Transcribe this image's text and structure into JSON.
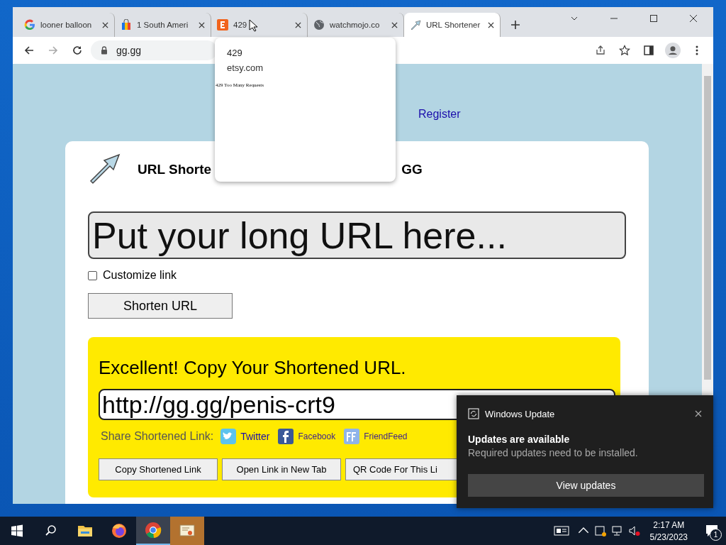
{
  "browser": {
    "tabs": [
      {
        "title": "looner balloon",
        "kind": "google",
        "selected": false
      },
      {
        "title": "1 South Ameri",
        "kind": "bag",
        "selected": false
      },
      {
        "title": "429",
        "kind": "etsy",
        "selected": false
      },
      {
        "title": "watchmojo.co",
        "kind": "globe",
        "selected": false
      },
      {
        "title": "URL Shortener",
        "kind": "arrow",
        "selected": true
      }
    ],
    "address": "gg.gg",
    "tab_preview": {
      "title": "429",
      "domain": "etsy.com",
      "page_text": "429 Too Many Requests"
    }
  },
  "page": {
    "register_link": "Register",
    "title_start": "URL Shorte",
    "title_end": "GG",
    "url_input": {
      "placeholder": "Put your long URL here..."
    },
    "customize": {
      "label": "Customize link",
      "checked": false
    },
    "shorten_button": "Shorten URL",
    "result": {
      "heading": "Excellent! Copy Your Shortened URL.",
      "url": "http://gg.gg/penis-crt9",
      "share_label": "Share Shortened Link:",
      "share_links": [
        {
          "kind": "twitter",
          "label": "Twitter"
        },
        {
          "kind": "facebook",
          "label": "Facebook"
        },
        {
          "kind": "friendfeed",
          "label": "FriendFeed"
        }
      ],
      "buttons": [
        "Copy Shortened Link",
        "Open Link in New Tab",
        "QR Code For This Li"
      ]
    }
  },
  "toast": {
    "app": "Windows Update",
    "title": "Updates are available",
    "message": "Required updates need to be installed.",
    "button": "View updates"
  },
  "taskbar": {
    "apps": [
      {
        "kind": "explorer",
        "active": false
      },
      {
        "kind": "firefox",
        "active": false
      },
      {
        "kind": "chrome",
        "active": true
      },
      {
        "kind": "certificate",
        "active": false
      }
    ],
    "time": "2:17 AM",
    "date": "5/23/2023",
    "notifications": "1"
  }
}
